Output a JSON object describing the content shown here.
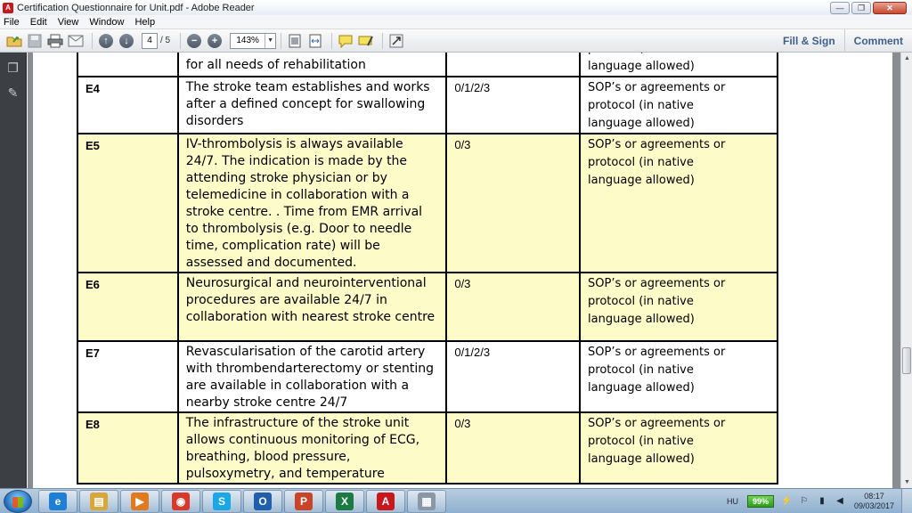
{
  "window": {
    "title": "Certification Questionnaire for Unit.pdf - Adobe Reader"
  },
  "menu": [
    "File",
    "Edit",
    "View",
    "Window",
    "Help"
  ],
  "toolbar": {
    "current_page": "4",
    "page_count": "/ 5",
    "zoom": "143%",
    "fill_sign": "Fill & Sign",
    "comment": "Comment"
  },
  "document": {
    "partial_top": {
      "desc": "for all needs of rehabilitation",
      "evidence": "protocol (in native language allowed)"
    },
    "rows": [
      {
        "code": "E4",
        "desc": "The stroke team establishes and works after a defined concept for swallowing disorders",
        "score": "0/1/2/3",
        "evidence": "SOP’s or agreements or protocol (in native language allowed)",
        "highlight": false
      },
      {
        "code": "E5",
        "desc": "IV-thrombolysis is always available 24/7. The indication is made by the attending stroke physician or by telemedicine in collaboration with a stroke centre. . Time from EMR arrival to thrombolysis (e.g. Door to needle time, complication rate) will be assessed and documented.",
        "score": "0/3",
        "evidence": "SOP’s or agreements or protocol (in native language allowed)",
        "highlight": true
      },
      {
        "code": "E6",
        "desc": "Neurosurgical  and neurointerventional procedures are available 24/7 in collaboration with nearest stroke centre",
        "score": "0/3",
        "evidence": "SOP’s or agreements or protocol (in native language allowed)",
        "highlight": true
      },
      {
        "code": "E7",
        "desc": "Revascularisation of the carotid artery with thrombendarterectomy or stenting are available in collaboration with a nearby stroke centre 24/7",
        "score": "0/1/2/3",
        "evidence": "SOP’s or agreements or protocol (in native language allowed)",
        "highlight": false
      },
      {
        "code": "E8",
        "desc": "The infrastructure of the stroke unit allows continuous monitoring of ECG, breathing, blood pressure, pulsoxymetry, and temperature",
        "score": "0/3",
        "evidence": "SOP’s or agreements or protocol (in native language allowed)",
        "highlight": true
      }
    ]
  },
  "taskbar": {
    "language": "HU",
    "battery": "99%",
    "time": "08:17",
    "date": "09/03/2017",
    "apps": [
      {
        "name": "internet-explorer",
        "glyph": "e",
        "color": "#1e7fd6"
      },
      {
        "name": "file-explorer",
        "glyph": "▤",
        "color": "#d9a63a"
      },
      {
        "name": "media-player",
        "glyph": "▶",
        "color": "#e27a1d"
      },
      {
        "name": "chrome",
        "glyph": "◉",
        "color": "#d8392b"
      },
      {
        "name": "skype",
        "glyph": "S",
        "color": "#1aa7e8"
      },
      {
        "name": "outlook",
        "glyph": "O",
        "color": "#1f5fae"
      },
      {
        "name": "powerpoint",
        "glyph": "P",
        "color": "#c9452a"
      },
      {
        "name": "excel",
        "glyph": "X",
        "color": "#1e7a43"
      },
      {
        "name": "acrobat",
        "glyph": "A",
        "color": "#c8171d"
      },
      {
        "name": "document-viewer",
        "glyph": "▦",
        "color": "#8a97a6"
      }
    ]
  },
  "colors": {
    "highlight_row": "#fdfbc8",
    "reader_gray": "#898c91",
    "toolbar_link": "#3f5f8c"
  }
}
